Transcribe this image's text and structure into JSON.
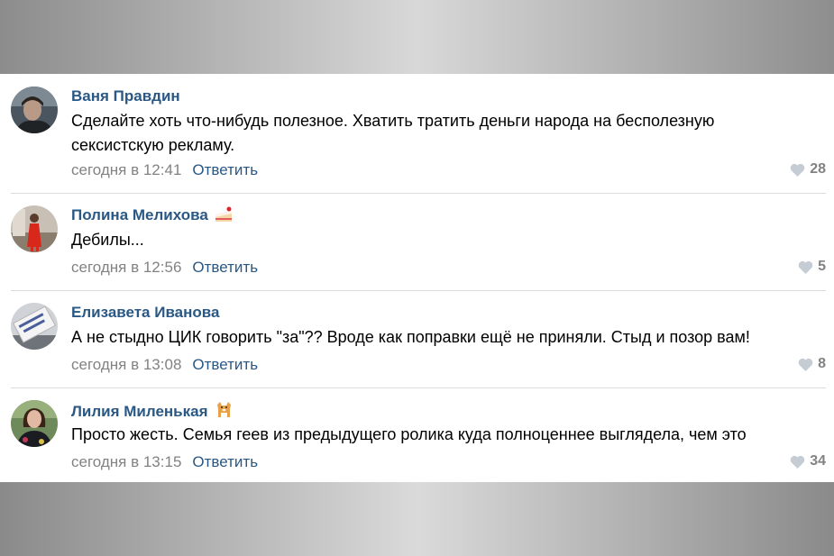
{
  "comments": [
    {
      "author": "Ваня Правдин",
      "text": "Сделайте хоть что-нибудь полезное. Хватить тратить деньги народа на бесполезную сексистскую рекламу.",
      "time": "сегодня в 12:41",
      "reply_label": "Ответить",
      "likes": "28",
      "avatar_icon": "person-photo-avatar"
    },
    {
      "author": "Полина Мелихова",
      "badge_icon": "cake-icon",
      "text": "Дебилы...",
      "time": "сегодня в 12:56",
      "reply_label": "Ответить",
      "likes": "5",
      "avatar_icon": "person-photo-avatar"
    },
    {
      "author": "Елизавета Иванова",
      "text": "А не стыдно ЦИК говорить \"за\"?? Вроде как поправки ещё не приняли. Стыд и позор вам!",
      "time": "сегодня в 13:08",
      "reply_label": "Ответить",
      "likes": "8",
      "avatar_icon": "sign-photo-avatar"
    },
    {
      "author": "Лилия Миленькая",
      "badge_icon": "dog-icon",
      "text": "Просто жесть. Семья геев из предыдущего ролика куда полноценнее выглядела, чем это",
      "time": "сегодня в 13:15",
      "reply_label": "Ответить",
      "likes": "34",
      "avatar_icon": "person-photo-avatar"
    }
  ],
  "colors": {
    "author": "#2a5885",
    "link": "#2a5885",
    "meta": "#828282",
    "divider": "#dcdcdc"
  }
}
